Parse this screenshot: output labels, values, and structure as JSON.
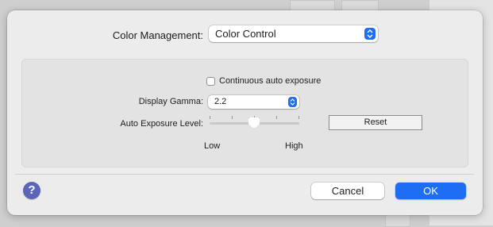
{
  "dialog": {
    "color_management": {
      "label": "Color Management:",
      "selected": "Color Control"
    },
    "group": {
      "checkbox": {
        "label": "Continuous auto exposure",
        "checked": false
      },
      "display_gamma": {
        "label": "Display Gamma:",
        "selected": "2.2"
      },
      "auto_exposure": {
        "label": "Auto Exposure Level:",
        "level_fraction": 0.5,
        "low_label": "Low",
        "high_label": "High"
      },
      "reset_label": "Reset"
    },
    "help_glyph": "?",
    "cancel_label": "Cancel",
    "ok_label": "OK"
  },
  "colors": {
    "accent": "#1e6df5",
    "help": "#5b66b9",
    "dialog_bg": "#ececec",
    "group_bg": "#e3e3e3"
  },
  "icons": {
    "help": "question-mark-icon",
    "popup_stepper": "up-down-chevron-icon"
  }
}
